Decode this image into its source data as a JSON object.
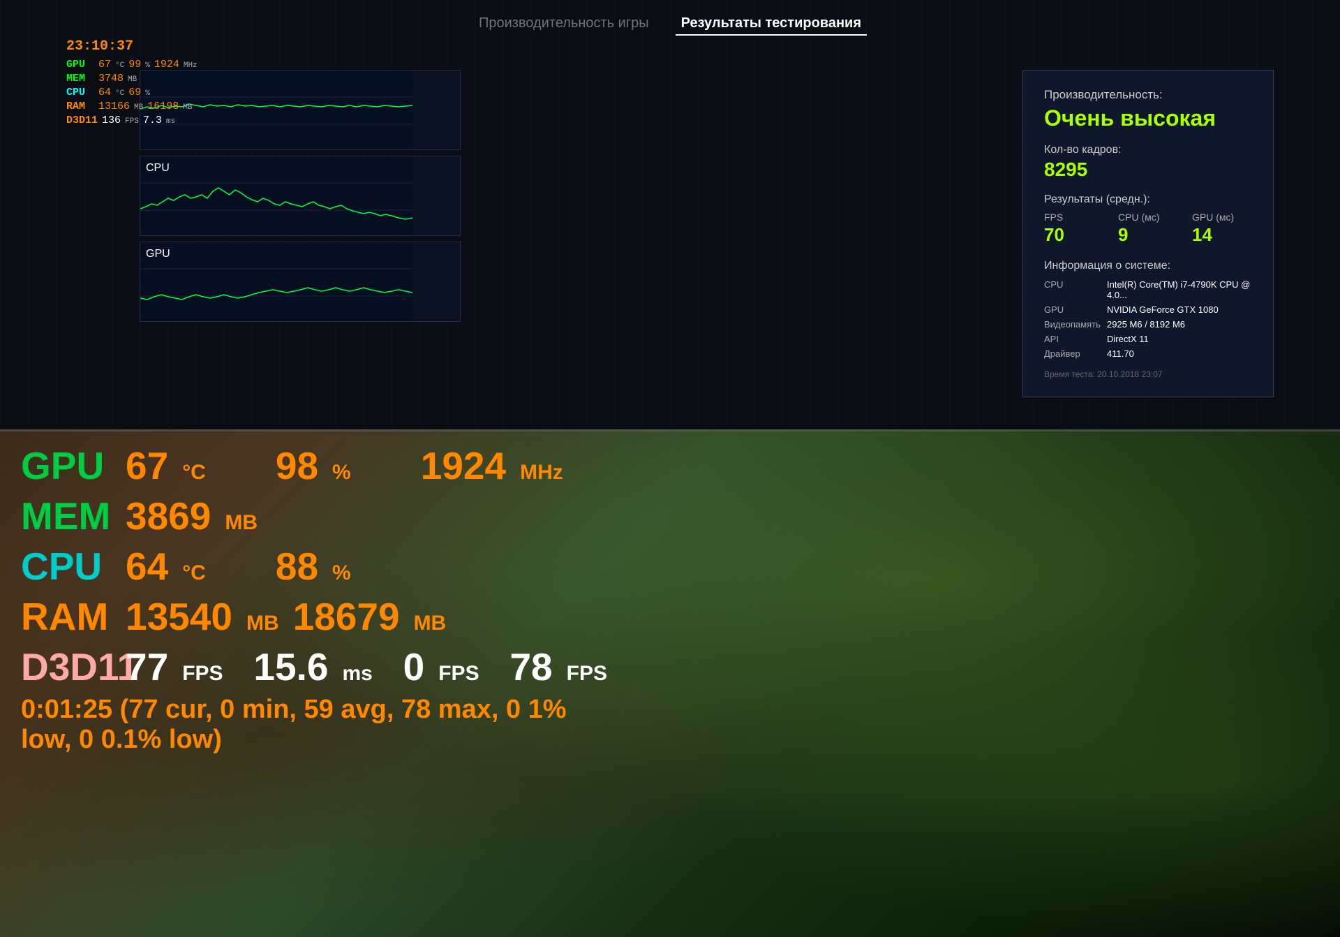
{
  "tabs": {
    "tab1": {
      "label": "Производительность игры"
    },
    "tab2": {
      "label": "Результаты тестирования",
      "active": true
    }
  },
  "hud_top": {
    "time": "23:10:37",
    "gpu_label": "GPU",
    "gpu_temp": "67",
    "gpu_temp_unit": "°C",
    "gpu_load": "99",
    "gpu_load_unit": "%",
    "gpu_clock": "1924",
    "gpu_clock_unit": "MHz",
    "mem_label": "MEM",
    "mem_val": "3748",
    "mem_unit": "MB",
    "cpu_label": "CPU",
    "cpu_temp": "64",
    "cpu_temp_unit": "°C",
    "cpu_load": "69",
    "cpu_load_unit": "%",
    "ram_label": "RAM",
    "ram_used": "13166",
    "ram_used_unit": "MB",
    "ram_total": "16198",
    "ram_total_unit": "MB",
    "d3d_label": "D3D11",
    "d3d_fps": "136",
    "d3d_fps_unit": "FPS",
    "d3d_ms": "7.3",
    "d3d_ms_unit": "ms"
  },
  "graph_fps": {
    "y_max": "123",
    "y_mid": "70",
    "y_min": "35"
  },
  "graph_cpu": {
    "label": "CPU",
    "y_max": "21",
    "y_mid": "9",
    "y_min": "6"
  },
  "graph_gpu": {
    "label": "GPU",
    "y_max": "21",
    "y_mid": "14",
    "y_min": "11"
  },
  "results": {
    "perf_label": "Производительность:",
    "perf_value": "Очень высокая",
    "frames_label": "Кол-во кадров:",
    "frames_value": "8295",
    "avg_label": "Результаты (средн.):",
    "fps_label": "FPS",
    "fps_value": "70",
    "cpu_ms_label": "CPU (мс)",
    "cpu_ms_value": "9",
    "gpu_ms_label": "GPU (мс)",
    "gpu_ms_value": "14",
    "sysinfo_label": "Информация о системе:",
    "cpu_key": "CPU",
    "cpu_val": "Intel(R) Core(TM) i7-4790K CPU @ 4.0...",
    "gpu_key": "GPU",
    "gpu_val": "NVIDIA GeForce GTX 1080",
    "vram_key": "Видеопамять",
    "vram_val": "2925 М6 / 8192 М6",
    "api_key": "API",
    "api_val": "DirectX 11",
    "driver_key": "Драйвер",
    "driver_val": "411.70",
    "timestamp": "Время теста: 20.10.2018 23:07"
  },
  "hud_bottom": {
    "gpu_label": "GPU",
    "gpu_temp": "67",
    "gpu_temp_unit": "°C",
    "gpu_load": "98",
    "gpu_load_unit": "%",
    "gpu_clock": "1924",
    "gpu_clock_unit": "MHz",
    "mem_label": "MEM",
    "mem_val": "3869",
    "mem_unit": "MB",
    "cpu_label": "CPU",
    "cpu_temp": "64",
    "cpu_temp_unit": "°C",
    "cpu_load": "88",
    "cpu_load_unit": "%",
    "ram_label": "RAM",
    "ram_used": "13540",
    "ram_used_unit": "MB",
    "ram_total": "18679",
    "ram_total_unit": "MB",
    "d3d_label": "D3D11",
    "d3d_fps": "77",
    "d3d_fps_unit": "FPS",
    "d3d_ms": "15.6",
    "d3d_ms_unit": "ms",
    "d3d_fps2": "0",
    "d3d_fps2_unit": "FPS",
    "d3d_fps3": "78",
    "d3d_fps3_unit": "FPS",
    "bottom_line": "0:01:25 (77 cur, 0 min, 59 avg, 78 max, 0 1% low, 0 0.1% low)"
  }
}
